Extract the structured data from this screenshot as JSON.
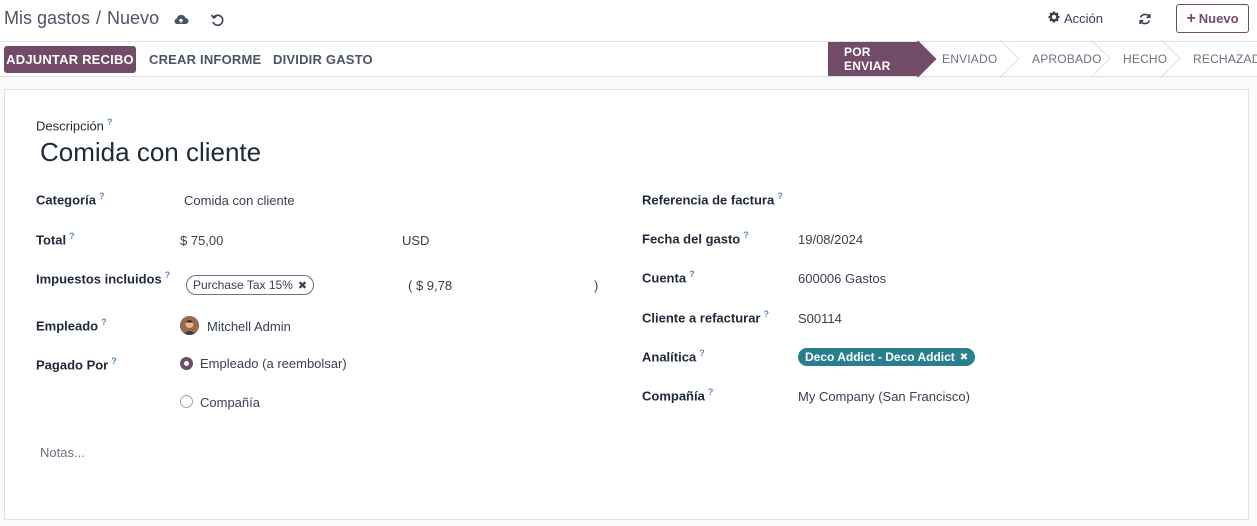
{
  "breadcrumb": {
    "parent": "Mis gastos",
    "separator": "/",
    "current": "Nuevo"
  },
  "header": {
    "accion_label": "Acción",
    "new_label": "Nuevo"
  },
  "actions": {
    "attach_label": "ADJUNTAR RECIBO",
    "report_label": "CREAR INFORME",
    "split_label": "DIVIDIR GASTO"
  },
  "stages": [
    {
      "label": "POR ENVIAR",
      "active": true
    },
    {
      "label": "ENVIADO",
      "active": false
    },
    {
      "label": "APROBADO",
      "active": false
    },
    {
      "label": "HECHO",
      "active": false
    },
    {
      "label": "RECHAZADO",
      "active": false
    }
  ],
  "form": {
    "description_label": "Descripción",
    "description_value": "Comida con cliente",
    "category_label": "Categoría",
    "category_value": "Comida con cliente",
    "total_label": "Total",
    "total_value": "$ 75,00",
    "currency": "USD",
    "taxes_label": "Impuestos incluidos",
    "tax_tag": "Purchase Tax 15%",
    "tax_amount": "( $ 9,78",
    "tax_close": ")",
    "employee_label": "Empleado",
    "employee_value": "Mitchell Admin",
    "paid_by_label": "Pagado Por",
    "paid_by_options": [
      "Empleado (a reembolsar)",
      "Compañía"
    ],
    "paid_by_selected": "Empleado (a reembolsar)",
    "invoice_ref_label": "Referencia de factura",
    "invoice_ref_value": "",
    "date_label": "Fecha del gasto",
    "date_value": "19/08/2024",
    "account_label": "Cuenta",
    "account_value": "600006 Gastos",
    "customer_label": "Cliente a refacturar",
    "customer_value": "S00114",
    "analytic_label": "Analítica",
    "analytic_tag": "Deco Addict - Deco Addict",
    "company_label": "Compañía",
    "company_value": "My Company (San Francisco)",
    "notes_placeholder": "Notas...",
    "help_marker": "?"
  },
  "colors": {
    "brand": "#714b67",
    "teal": "#2a7f8e",
    "help": "#5c8ab8"
  },
  "icons": [
    "cloud-upload-icon",
    "discard-icon",
    "gear-icon",
    "refresh-icon",
    "plus-icon",
    "remove-tag-icon"
  ]
}
